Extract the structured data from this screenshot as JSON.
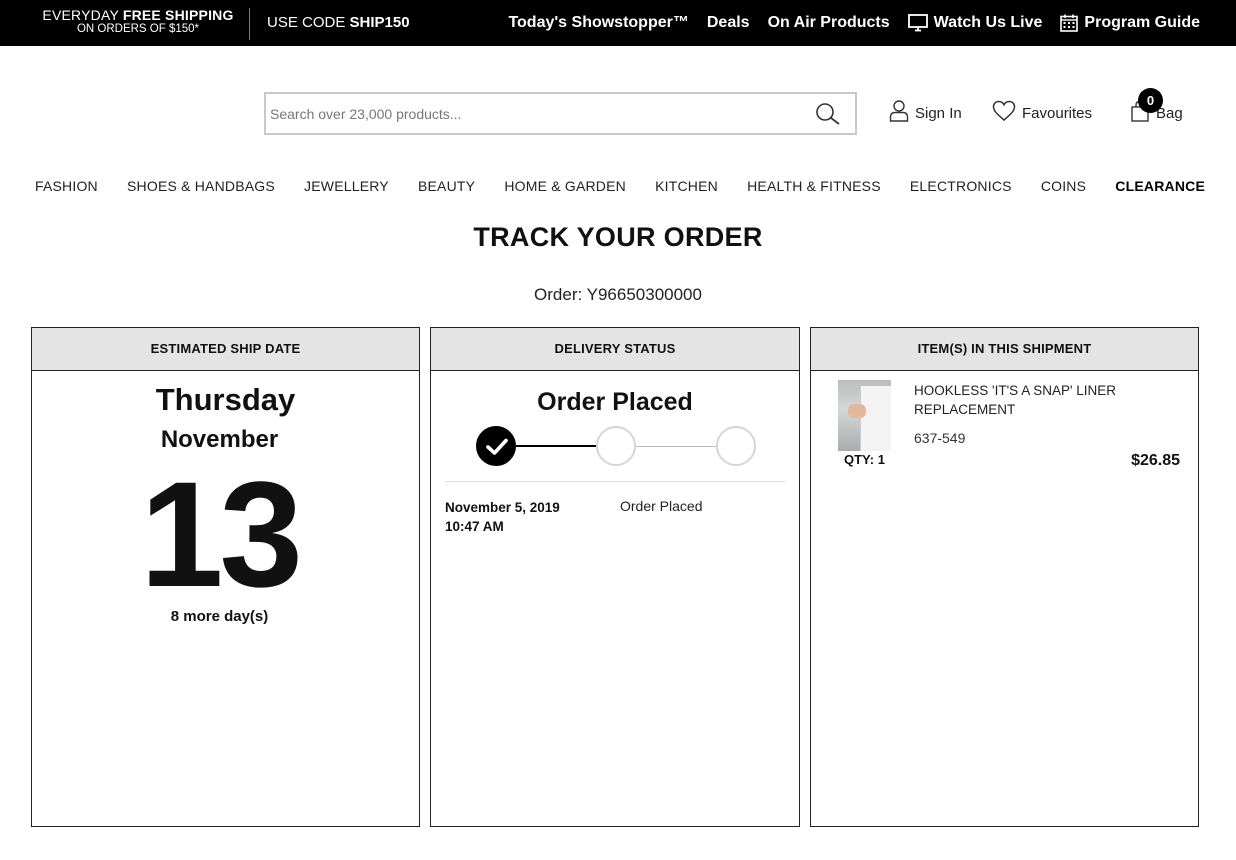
{
  "promo": {
    "line1_prefix": "EVERYDAY ",
    "line1_strong": "FREE SHIPPING",
    "line2": "ON ORDERS OF $150*",
    "code_prefix": "USE CODE ",
    "code": "SHIP150"
  },
  "top_nav": [
    {
      "label": "Today's Showstopper™",
      "icon": ""
    },
    {
      "label": "Deals",
      "icon": ""
    },
    {
      "label": "On Air Products",
      "icon": ""
    },
    {
      "label": "Watch Us Live",
      "icon": "tv-icon"
    },
    {
      "label": "Program Guide",
      "icon": "calendar-icon"
    }
  ],
  "header": {
    "search_placeholder": "Search over 23,000 products...",
    "sign_in": "Sign In",
    "favourites": "Favourites",
    "bag": "Bag",
    "bag_count": "0"
  },
  "categories": [
    "FASHION",
    "SHOES & HANDBAGS",
    "JEWELLERY",
    "BEAUTY",
    "HOME & GARDEN",
    "KITCHEN",
    "HEALTH & FITNESS",
    "ELECTRONICS",
    "COINS",
    "CLEARANCE"
  ],
  "page": {
    "title": "TRACK YOUR ORDER",
    "order_label": "Order: Y96650300000"
  },
  "ship_date": {
    "header": "ESTIMATED SHIP DATE",
    "weekday": "Thursday",
    "month": "November",
    "day": "13",
    "remaining": "8 more day(s)"
  },
  "delivery": {
    "header": "DELIVERY STATUS",
    "status": "Order Placed",
    "steps_total": 3,
    "steps_completed": 1,
    "events": [
      {
        "date": "November 5, 2019",
        "time": "10:47 AM",
        "status": "Order Placed"
      }
    ]
  },
  "shipment": {
    "header": "ITEM(S) IN THIS SHIPMENT",
    "items": [
      {
        "name": "HOOKLESS 'IT'S A SNAP' LINER REPLACEMENT",
        "sku": "637-549",
        "qty": "QTY: 1",
        "price": "$26.85"
      }
    ]
  }
}
